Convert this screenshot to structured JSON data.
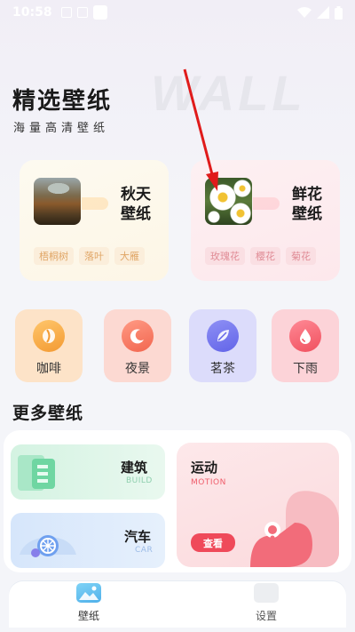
{
  "status_bar": {
    "time": "10:58"
  },
  "watermark": "WALL",
  "header": {
    "title": "精选壁纸",
    "subtitle": "海量高清壁纸"
  },
  "featured": [
    {
      "name": "秋天壁纸",
      "tags": [
        "梧桐树",
        "落叶",
        "大雁"
      ]
    },
    {
      "name": "鲜花壁纸",
      "tags": [
        "玫瑰花",
        "樱花",
        "菊花"
      ]
    }
  ],
  "categories": [
    {
      "label": "咖啡",
      "icon": "coffee-bean-icon"
    },
    {
      "label": "夜景",
      "icon": "moon-icon"
    },
    {
      "label": "茗茶",
      "icon": "leaf-icon"
    },
    {
      "label": "下雨",
      "icon": "raindrop-icon"
    }
  ],
  "more": {
    "title": "更多壁纸",
    "build": {
      "title": "建筑",
      "sub": "BUILD"
    },
    "car": {
      "title": "汽车",
      "sub": "CAR"
    },
    "motion": {
      "title": "运动",
      "sub": "MOTION",
      "button": "查看"
    }
  },
  "nav": [
    {
      "label": "壁纸",
      "active": true
    },
    {
      "label": "设置",
      "active": false
    }
  ],
  "colors": {
    "accent_red": "#ef4a5a",
    "annotation_arrow": "#e01b1b"
  }
}
